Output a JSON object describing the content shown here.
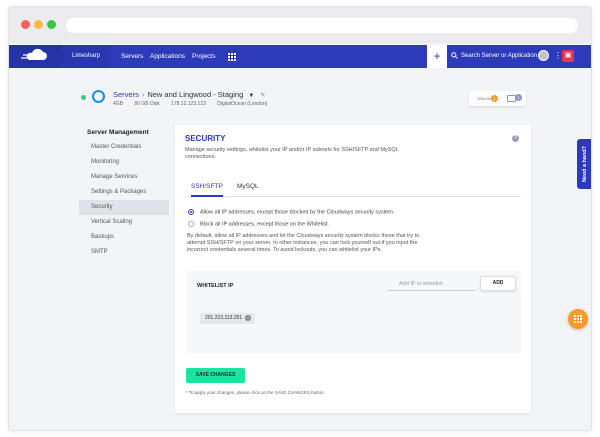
{
  "nav": {
    "project": "Limesharp",
    "items": [
      "Servers",
      "Applications",
      "Projects"
    ],
    "search_placeholder": "Search Server or Application",
    "plus_icon": "plus-icon",
    "gift_icon": "gift-icon",
    "accent": "#2d3ab9"
  },
  "server": {
    "breadcrumb_root": "Servers",
    "name": "New and Lingwood - Staging",
    "meta": [
      "4GB",
      "80 GB Disk",
      "178.12.123.123",
      "DigitalOcean (London)"
    ],
    "status_color": "#2bd17f"
  },
  "notifications": {
    "label": "ONLINE",
    "count_a": "1",
    "count_b": "1"
  },
  "sidebar": {
    "heading": "Server Management",
    "items": [
      "Master Credentials",
      "Monitoring",
      "Manage Services",
      "Settings & Packages",
      "Security",
      "Vertical Scaling",
      "Backups",
      "SMTP"
    ],
    "active": "Security"
  },
  "security": {
    "title": "SECURITY",
    "description": "Manage security settings, whitelist your IP and/or IP subnets for SSH/SFTP and MySQL connections.",
    "tabs": [
      "SSH/SFTP",
      "MySQL"
    ],
    "active_tab": "SSH/SFTP",
    "radio_1": "Allow all IP addresses, except those blocked by the Cloudways security system.",
    "radio_2": "Block all IP addresses, except those on the Whitelist.",
    "selected_radio": "radio_1",
    "paragraph": "By default, allow all IP addresses and let the Cloudways security system blocks those that try to attempt SSH/SFTP on your server. In other instances, you can lock yourself out if you input the incorrect credentials several times. To avoid lockouts, you can whitelist your IPs.",
    "whitelist_label": "WHITELIST IP",
    "whitelist_placeholder": "Add IP to whitelist",
    "add_button": "ADD",
    "ips": [
      "201.213.113.251"
    ],
    "save_button": "SAVE CHANGES",
    "footnote": "* To apply your changes, please click on the SAVE CHANGES button.",
    "save_color": "#1de3a1"
  },
  "help_tab": "Need a hand?",
  "fab_color": "#f79a2b"
}
